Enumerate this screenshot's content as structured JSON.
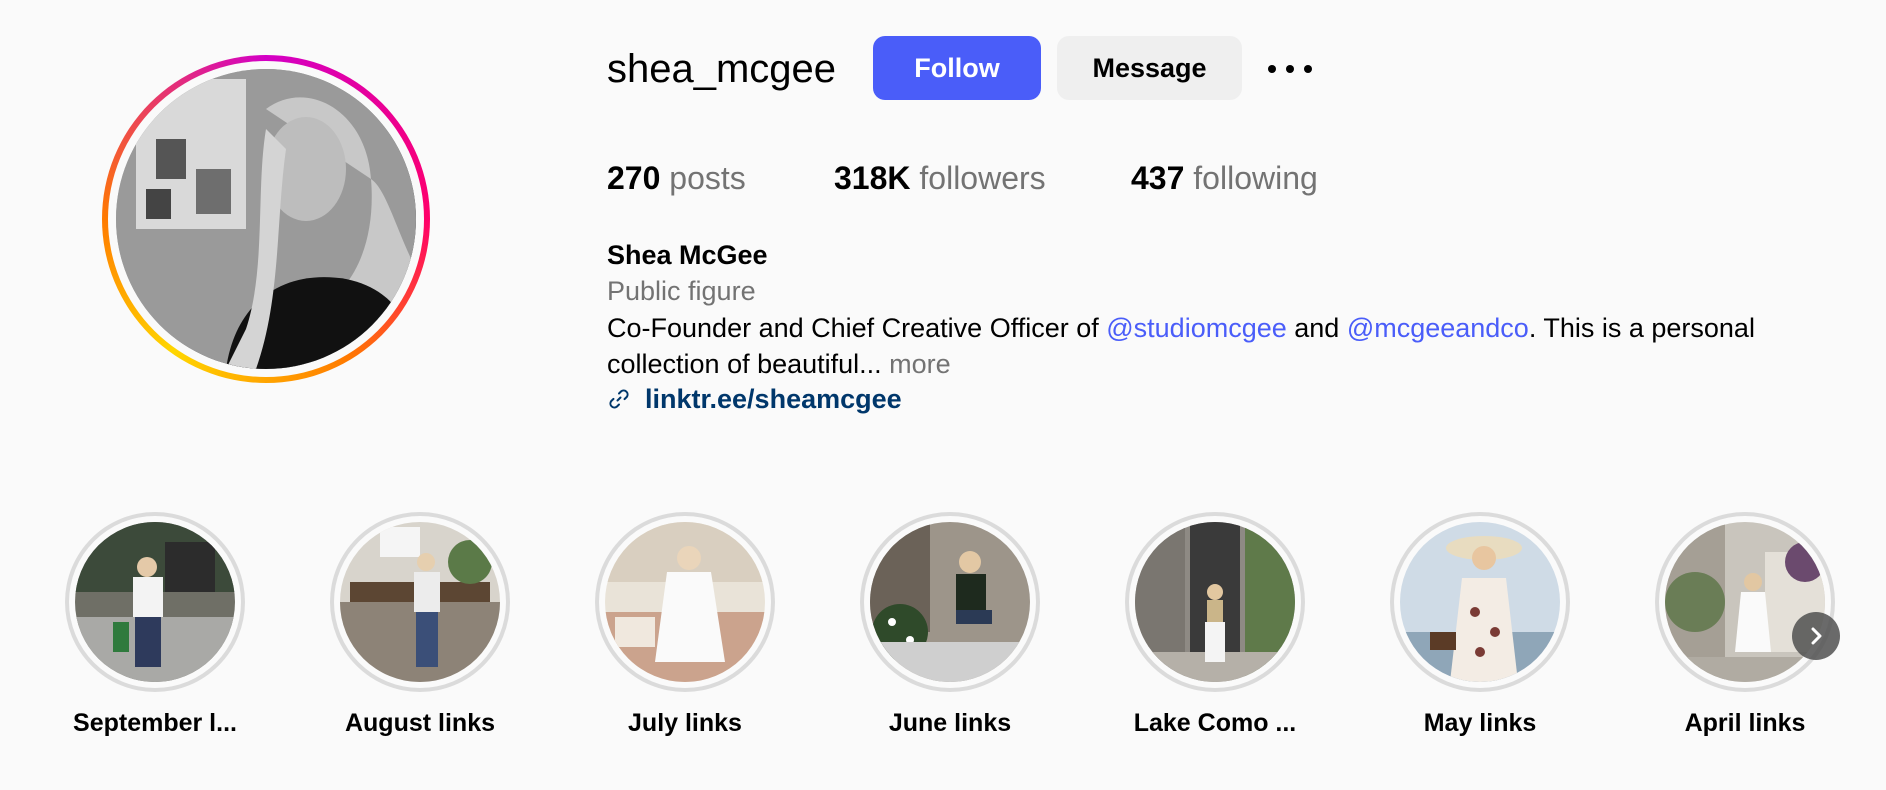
{
  "profile": {
    "username": "shea_mcgee",
    "follow_label": "Follow",
    "message_label": "Message",
    "more_icon": "ellipsis-icon",
    "stats": {
      "posts_count": "270",
      "posts_label": "posts",
      "followers_count": "318K",
      "followers_label": "followers",
      "following_count": "437",
      "following_label": "following"
    },
    "bio": {
      "name": "Shea McGee",
      "category": "Public figure",
      "text_1": "Co-Founder and Chief Creative Officer of ",
      "mention_1": "@studiomcgee",
      "text_2": " and ",
      "mention_2": "@mcgeeandco",
      "text_3": ". This is a personal collection of beautiful...",
      "more": " more",
      "link": "linktr.ee/sheamcgee"
    }
  },
  "highlights": [
    {
      "label": "September l..."
    },
    {
      "label": "August links"
    },
    {
      "label": "July links"
    },
    {
      "label": "June links"
    },
    {
      "label": "Lake Como ..."
    },
    {
      "label": "May links"
    },
    {
      "label": "April links"
    }
  ],
  "colors": {
    "accent": "#4a5df9",
    "link": "#00376b",
    "muted": "#737373",
    "background": "#fafafa"
  }
}
